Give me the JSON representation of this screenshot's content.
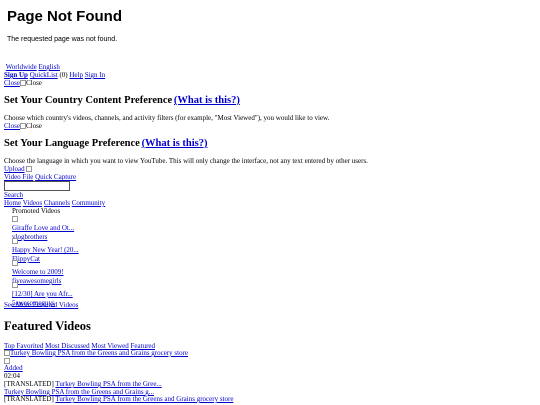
{
  "error": {
    "title": "Page Not Found",
    "message": "The requested page was not found."
  },
  "top": {
    "worldwide": "Worldwide",
    "english": "English",
    "sign_up": "Sign Up",
    "quicklist": "QuickList",
    "quicklist_count": "(0)",
    "help": "Help",
    "sign_in": "Sign In",
    "close_link": "Close",
    "close_text": "Close"
  },
  "country": {
    "heading": "Set Your Country Content Preference",
    "what_link": "(What is this?)",
    "desc": "Choose which country's videos, channels, and activity filters (for example, \"Most Viewed\"), you would like to view.",
    "close_link": "Close",
    "close_text": "Close"
  },
  "language": {
    "heading": "Set Your Language Preference",
    "what_link": "(What is this?)",
    "desc": "Choose the language in which you want to view YouTube. This will only change the interface, not any text entered by other users."
  },
  "upload": {
    "upload_label": "Upload",
    "video_file": "Video File",
    "quick_capture": "Quick Capture",
    "search_value": "",
    "search_label": "Search"
  },
  "nav": {
    "home": "Home",
    "videos": "Videos",
    "channels": "Channels",
    "community": "Community"
  },
  "promoted": {
    "heading": "Promoted Videos",
    "items": [
      {
        "title": "Giraffe Love and Ot...",
        "user": "vlogbrothers"
      },
      {
        "title": "Happy New Year! (20...",
        "user": "FlippyCat"
      },
      {
        "title": "Welcome to 2009!",
        "user": "fiveawesomegirls"
      },
      {
        "title": "[12/30] Are you Afr...",
        "user": "5awesomeguys"
      }
    ],
    "see_more": "See More Featured Videos"
  },
  "featured": {
    "heading": "Featured Videos",
    "tabs": [
      "Top Favorited",
      "Most Discussed",
      "Most Viewed",
      "Featured"
    ],
    "img_alt": "Turkey Bowling PSA from the Greens and Grains grocery store",
    "added": "Added",
    "duration": "02:04",
    "translated": "[TRANSLATED]",
    "short_title": "Turkey Bowling PSA from the Gree...",
    "mid_title": "Turkey Bowling PSA from the Greens and Grains g...",
    "full_title": "Turkey Bowling PSA from the Greens and Grains grocery store"
  }
}
